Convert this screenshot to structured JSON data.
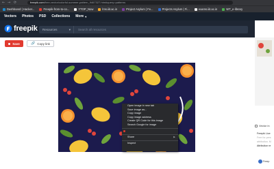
{
  "browser": {
    "nav_back": "←",
    "nav_forward": "→",
    "nav_reload": "⟳",
    "url_domain": "freepik.com",
    "url_path": "/free-vector/colorful-summer-pattern_9467327.htm#query=patterns",
    "bookmarks": [
      {
        "label": "Dashboard | Hacker...",
        "color": "#1f8acb"
      },
      {
        "label": "Freepik-from-to-co...",
        "color": "#e13a2f"
      },
      {
        "label": "YTOP_Now",
        "color": "#f2f2f2"
      },
      {
        "label": "lms.iiit.ac.in",
        "color": "#f5a623"
      },
      {
        "label": "Project Asylum | Fe...",
        "color": "#7b3fa0"
      },
      {
        "label": "Projects Asylum | Fi...",
        "color": "#2d6bd1"
      },
      {
        "label": "exams.iiit.ac.in",
        "color": "#f2f2f2"
      },
      {
        "label": "WT_e-library",
        "color": "#4caf50"
      }
    ]
  },
  "fpnav": {
    "items": [
      "Vectors",
      "Photos",
      "PSD",
      "Collections"
    ],
    "more": "More",
    "more_chevron": "chevron-down-icon"
  },
  "header": {
    "logo_text": "freepik",
    "category": "Resources",
    "search_placeholder": "Search all resources"
  },
  "actions": {
    "save_label": "Save",
    "copy_label": "Copy link"
  },
  "context_menu": {
    "group1": [
      "Open image in new tab",
      "Save image as...",
      "Copy image",
      "Copy image address",
      "Create QR Code for this image",
      "Search Google for image"
    ],
    "group2": [
      "Share"
    ],
    "group3": [
      "Inspect"
    ]
  },
  "sidebar": {
    "vector_label": "Vector in",
    "lines": [
      "Freepik Lice",
      "Free for pers",
      "attribution. M"
    ],
    "attribution": "Attribution re",
    "user": "Freep"
  },
  "colors": {
    "background": "#1c1b4d",
    "lemon": "#f5c53a",
    "orange": "#f5912e",
    "berry": "#e0453c",
    "leaf": "#6ea33c",
    "brand_red": "#e13a2f"
  }
}
